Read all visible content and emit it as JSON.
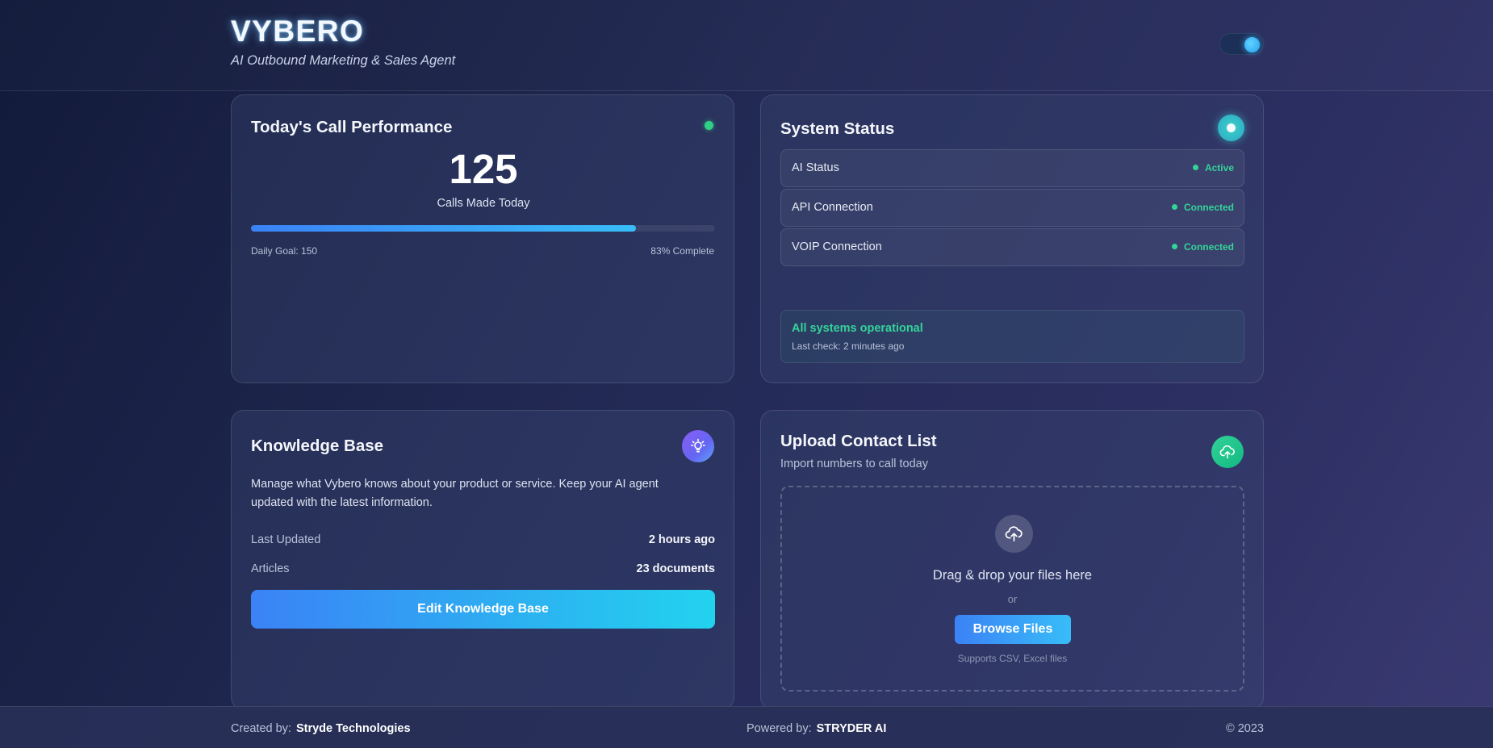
{
  "header": {
    "title": "VYBERO",
    "subtitle": "AI Outbound Marketing & Sales Agent"
  },
  "performance": {
    "title": "Today's Call Performance",
    "calls_count": "125",
    "calls_label": "Calls Made Today",
    "goal_label": "Daily Goal: 150",
    "complete_label": "83% Complete",
    "progress_percent": 83
  },
  "system_status": {
    "title": "System Status",
    "rows": [
      {
        "label": "AI Status",
        "value": "Active"
      },
      {
        "label": "API Connection",
        "value": "Connected"
      },
      {
        "label": "VOIP Connection",
        "value": "Connected"
      }
    ],
    "ops_title": "All systems operational",
    "ops_sub": "Last check: 2 minutes ago"
  },
  "knowledge_base": {
    "title": "Knowledge Base",
    "description": "Manage what Vybero knows about your product or service. Keep your AI agent updated with the latest information.",
    "last_updated_label": "Last Updated",
    "last_updated_value": "2 hours ago",
    "articles_label": "Articles",
    "articles_value": "23 documents",
    "button_label": "Edit Knowledge Base"
  },
  "upload": {
    "title": "Upload Contact List",
    "subtitle": "Import numbers to call today",
    "drop_title": "Drag & drop your files here",
    "or_text": "or",
    "browse_label": "Browse Files",
    "supports_text": "Supports CSV, Excel files"
  },
  "footer": {
    "created_label": "Created by:",
    "created_value": "Stryde Technologies",
    "powered_label": "Powered by:",
    "powered_value": "STRYDER AI",
    "copyright": "© 2023"
  },
  "colors": {
    "accent_blue": "#3b82f6",
    "accent_cyan": "#22d3ee",
    "status_green": "#34d399",
    "kb_purple": "#8b5cf6"
  },
  "icons": {
    "theme_toggle": "toggle-switch-icon",
    "live_indicator": "status-dot-icon",
    "system_status": "radio-circle-icon",
    "knowledge_base": "lightbulb-icon",
    "upload": "cloud-upload-icon",
    "dropzone": "cloud-upload-icon"
  }
}
